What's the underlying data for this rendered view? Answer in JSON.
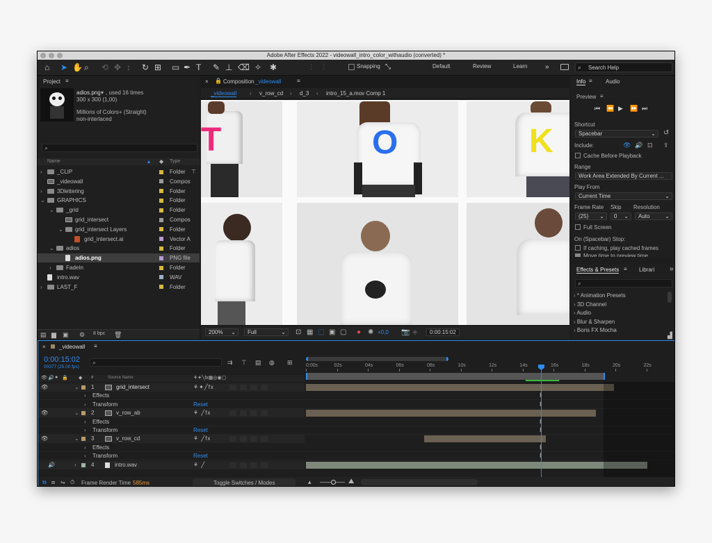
{
  "window": {
    "title": "Adobe After Effects 2022 - videowall_intro_color_withaudio (converted) *"
  },
  "toolbar": {
    "snapping": "Snapping",
    "workspaces": [
      "Default",
      "Review",
      "Learn"
    ],
    "search_help": "Search Help"
  },
  "project": {
    "tab": "Project",
    "asset_name": "adios.png",
    "asset_used": ", used 16 times",
    "asset_dims": "300 x 300 (1,00)",
    "asset_colors": "Millions of Colors+ (Straight)",
    "asset_interlace": "non-interlaced",
    "col_name": "Name",
    "col_type": "Type",
    "bpc": "8 bpc",
    "items": [
      {
        "name": "_CLIP",
        "type": "Folder"
      },
      {
        "name": "_videowall",
        "type": "Compos"
      },
      {
        "name": "3Dlettering",
        "type": "Folder"
      },
      {
        "name": "GRAPHICS",
        "type": "Folder"
      },
      {
        "name": "_grid",
        "type": "Folder"
      },
      {
        "name": "grid_intersect",
        "type": "Compos"
      },
      {
        "name": "grid_intersect Layers",
        "type": "Folder"
      },
      {
        "name": "grid_intersect.ai",
        "type": "Vector A"
      },
      {
        "name": "adios",
        "type": "Folder"
      },
      {
        "name": "adios.png",
        "type": "PNG file"
      },
      {
        "name": "FadeIn",
        "type": "Folder"
      },
      {
        "name": "intro.wav",
        "type": "WAV"
      },
      {
        "name": "LAST_F",
        "type": "Folder"
      }
    ]
  },
  "composition": {
    "tab_prefix": "Composition",
    "tab_name": "_videowall",
    "breadcrumbs": [
      "_videowall",
      "v_row_cd",
      "d_3",
      "intro_15_a.mov Comp 1"
    ],
    "zoom": "200%",
    "resolution": "Full",
    "exposure": "+0,0",
    "timecode": "0:00:15:02",
    "letters": [
      "T",
      "O",
      "K"
    ]
  },
  "info": {
    "tabs": [
      "Info",
      "Audio"
    ],
    "preview_title": "Preview",
    "shortcut_label": "Shortcut",
    "shortcut_value": "Spacebar",
    "include_label": "Include:",
    "cache_label": "Cache Before Playback",
    "range_label": "Range",
    "range_value": "Work Area Extended By Current ...",
    "play_from_label": "Play From",
    "play_from_value": "Current Time",
    "frame_rate_label": "Frame Rate",
    "skip_label": "Skip",
    "resolution_label": "Resolution",
    "frame_rate_value": "(25)",
    "skip_value": "0",
    "resolution_value": "Auto",
    "full_screen": "Full Screen",
    "on_stop": "On (Spacebar) Stop:",
    "if_caching": "If caching, play cached frames",
    "move_time": "Move time to preview time"
  },
  "effects": {
    "tabs": [
      "Effects & Presets",
      "Librari"
    ],
    "items": [
      "* Animation Presets",
      "3D Channel",
      "Audio",
      "Blur & Sharpen",
      "Boris FX Mocha"
    ]
  },
  "timeline": {
    "tab": "_videowall",
    "timecode": "0:00:15:02",
    "frames": "00377 (25.00 fps)",
    "col_source": "Source Name",
    "ruler": [
      "0:00s",
      "02s",
      "04s",
      "06s",
      "08s",
      "10s",
      "12s",
      "14s",
      "16s",
      "18s",
      "20s",
      "22s"
    ],
    "layers": [
      {
        "num": "1",
        "name": "grid_intersect"
      },
      {
        "num": "2",
        "name": "v_row_ab"
      },
      {
        "num": "3",
        "name": "v_row_cd"
      },
      {
        "num": "4",
        "name": "intro.wav"
      }
    ],
    "effects_label": "Effects",
    "transform_label": "Transform",
    "reset_label": "Reset",
    "render_label": "Frame Render Time",
    "render_value": "585ms",
    "toggle_label": "Toggle Switches / Modes"
  },
  "colors": {
    "accent_blue": "#2d8cf0",
    "folder_yellow": "#d7b93e",
    "comp_gray": "#9b9b9b"
  }
}
